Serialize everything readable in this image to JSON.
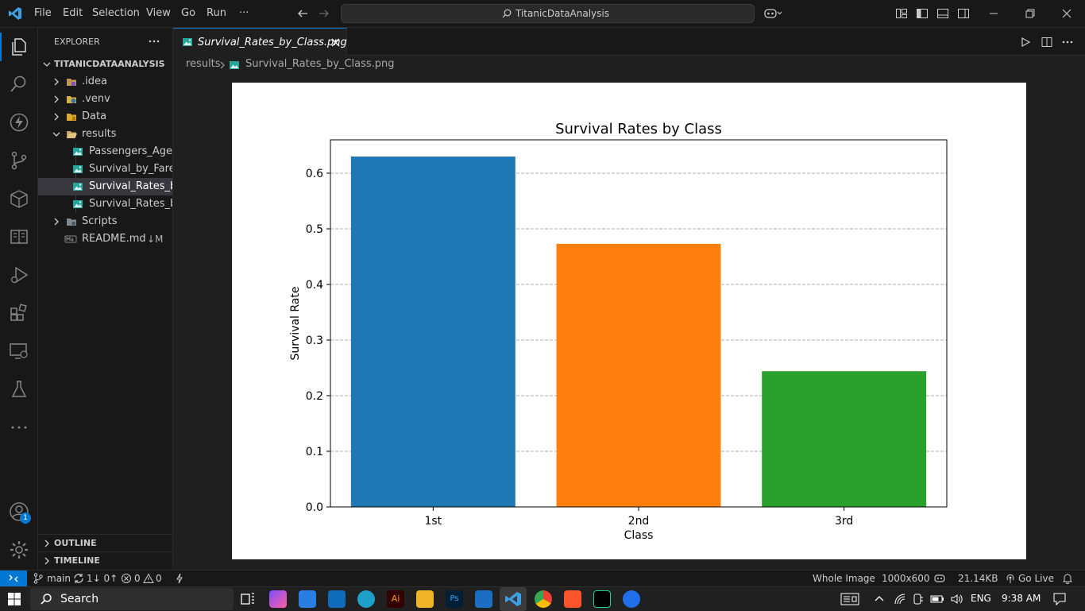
{
  "titlebar": {
    "menus": [
      "File",
      "Edit",
      "Selection",
      "View",
      "Go",
      "Run",
      "···"
    ],
    "command_center": "TitanicDataAnalysis"
  },
  "sidebar": {
    "header": "EXPLORER",
    "root": "TITANICDATAANALYSIS",
    "items": [
      {
        "label": ".idea",
        "type": "folder",
        "icon": "idea-folder-icon"
      },
      {
        "label": ".venv",
        "type": "folder",
        "icon": "python-folder-icon"
      },
      {
        "label": "Data",
        "type": "folder",
        "icon": "data-folder-icon"
      },
      {
        "label": "results",
        "type": "folder-open",
        "icon": "folder-open-icon"
      },
      {
        "label": "Passengers_Age...",
        "type": "file",
        "icon": "image-file-icon"
      },
      {
        "label": "Survival_by_Fare...",
        "type": "file",
        "icon": "image-file-icon"
      },
      {
        "label": "Survival_Rates_b...",
        "type": "file",
        "icon": "image-file-icon",
        "selected": true
      },
      {
        "label": "Survival_Rates_b...",
        "type": "file",
        "icon": "image-file-icon"
      },
      {
        "label": "Scripts",
        "type": "folder",
        "icon": "scripts-folder-icon"
      },
      {
        "label": "README.md",
        "type": "file",
        "icon": "markdown-file-icon",
        "badge": "↓M"
      }
    ],
    "outline": "OUTLINE",
    "timeline": "TIMELINE",
    "account_badge": "1"
  },
  "editor": {
    "tab_label": "Survival_Rates_by_Class.png",
    "breadcrumb_folder": "results",
    "breadcrumb_file": "Survival_Rates_by_Class.png"
  },
  "chart_data": {
    "type": "bar",
    "title": "Survival Rates by Class",
    "xlabel": "Class",
    "ylabel": "Survival Rate",
    "categories": [
      "1st",
      "2nd",
      "3rd"
    ],
    "values": [
      0.63,
      0.473,
      0.244
    ],
    "colors": [
      "#1f77b4",
      "#ff7f0e",
      "#2ca02c"
    ],
    "ylim": [
      0,
      0.66
    ],
    "yticks": [
      0.0,
      0.1,
      0.2,
      0.3,
      0.4,
      0.5,
      0.6
    ],
    "ytick_labels": [
      "0.0",
      "0.1",
      "0.2",
      "0.3",
      "0.4",
      "0.5",
      "0.6"
    ],
    "grid": "y-dashed"
  },
  "statusbar": {
    "branch": "main",
    "sync": "1↓ 0↑",
    "errors": "0",
    "warnings": "0",
    "view_mode": "Whole Image",
    "dimensions": "1000x600",
    "filesize": "21.14KB",
    "golive": "Go Live"
  },
  "taskbar": {
    "search_placeholder": "Search",
    "language": "ENG",
    "time": "9:38 AM"
  }
}
